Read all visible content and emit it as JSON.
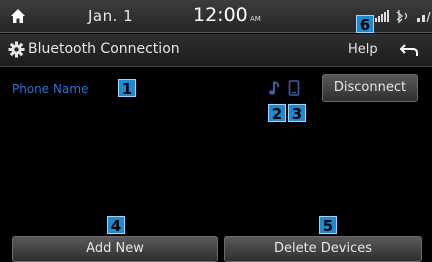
{
  "status_bar": {
    "date": "Jan.  1",
    "time": "12:00",
    "ampm": "AM",
    "icons": [
      "home-icon",
      "signal-icon",
      "bluetooth-icon"
    ]
  },
  "title_bar": {
    "title": "Bluetooth Connection",
    "help_label": "Help",
    "icons": [
      "gear-icon",
      "back-icon"
    ]
  },
  "device": {
    "phone_name": "Phone Name",
    "icons": [
      "music-note-icon",
      "phone-icon"
    ],
    "disconnect_label": "Disconnect"
  },
  "bottom_buttons": {
    "add_new_label": "Add New",
    "delete_devices_label": "Delete Devices"
  },
  "callouts": [
    "1",
    "2",
    "3",
    "4",
    "5",
    "6"
  ],
  "colors": {
    "phone_name": "#2d6fd6",
    "callout_bg": "#1f8ad0",
    "bar_bg": "#2a2a2a",
    "button_bg": "#4a4a4a"
  }
}
